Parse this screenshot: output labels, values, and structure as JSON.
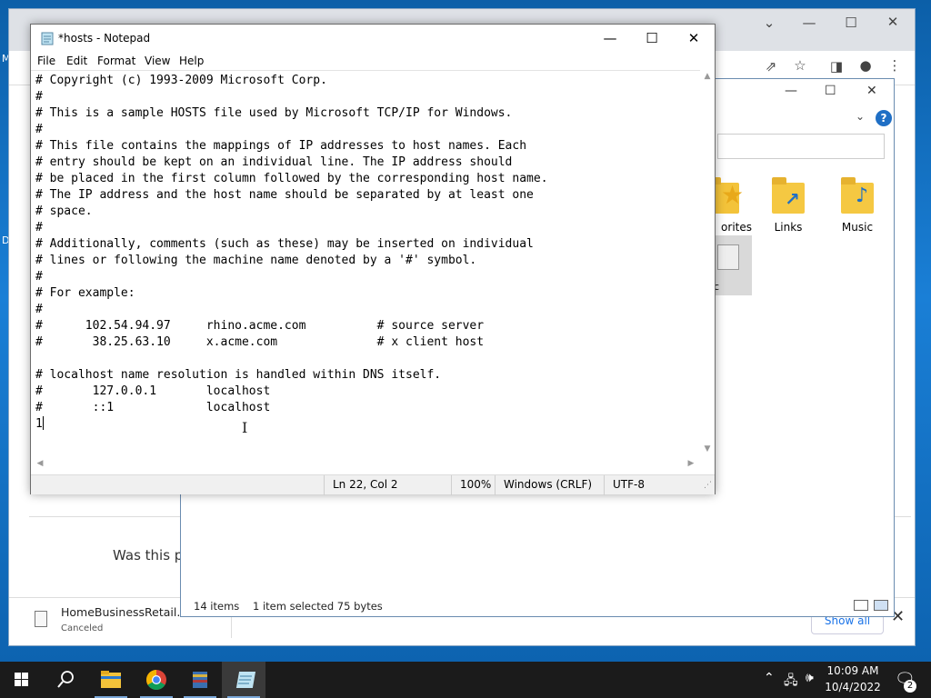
{
  "desktop": {
    "labels": [
      "M",
      "D"
    ]
  },
  "chrome": {
    "feedback_text": "Was this pa",
    "download": {
      "filename": "HomeBusinessRetail.img",
      "status": "Canceled",
      "show_all_label": "Show all"
    }
  },
  "explorer": {
    "folders": [
      {
        "label": "orites"
      },
      {
        "label": "Links"
      },
      {
        "label": "Music"
      }
    ],
    "selected_label": "c",
    "status": {
      "items_count": "14 items",
      "selection": "1 item selected  75 bytes"
    }
  },
  "notepad": {
    "title": "*hosts - Notepad",
    "menu": [
      "File",
      "Edit",
      "Format",
      "View",
      "Help"
    ],
    "lines": [
      "# Copyright (c) 1993-2009 Microsoft Corp.",
      "#",
      "# This is a sample HOSTS file used by Microsoft TCP/IP for Windows.",
      "#",
      "# This file contains the mappings of IP addresses to host names. Each",
      "# entry should be kept on an individual line. The IP address should",
      "# be placed in the first column followed by the corresponding host name.",
      "# The IP address and the host name should be separated by at least one",
      "# space.",
      "#",
      "# Additionally, comments (such as these) may be inserted on individual",
      "# lines or following the machine name denoted by a '#' symbol.",
      "#",
      "# For example:",
      "#",
      "#      102.54.94.97     rhino.acme.com          # source server",
      "#       38.25.63.10     x.acme.com              # x client host",
      "",
      "# localhost name resolution is handled within DNS itself.",
      "#       127.0.0.1       localhost",
      "#       ::1             localhost",
      "1"
    ],
    "status": {
      "position": "Ln 22, Col 2",
      "zoom": "100%",
      "line_endings": "Windows (CRLF)",
      "encoding": "UTF-8"
    }
  },
  "taskbar": {
    "time": "10:09 AM",
    "date": "10/4/2022",
    "notification_count": "2"
  }
}
